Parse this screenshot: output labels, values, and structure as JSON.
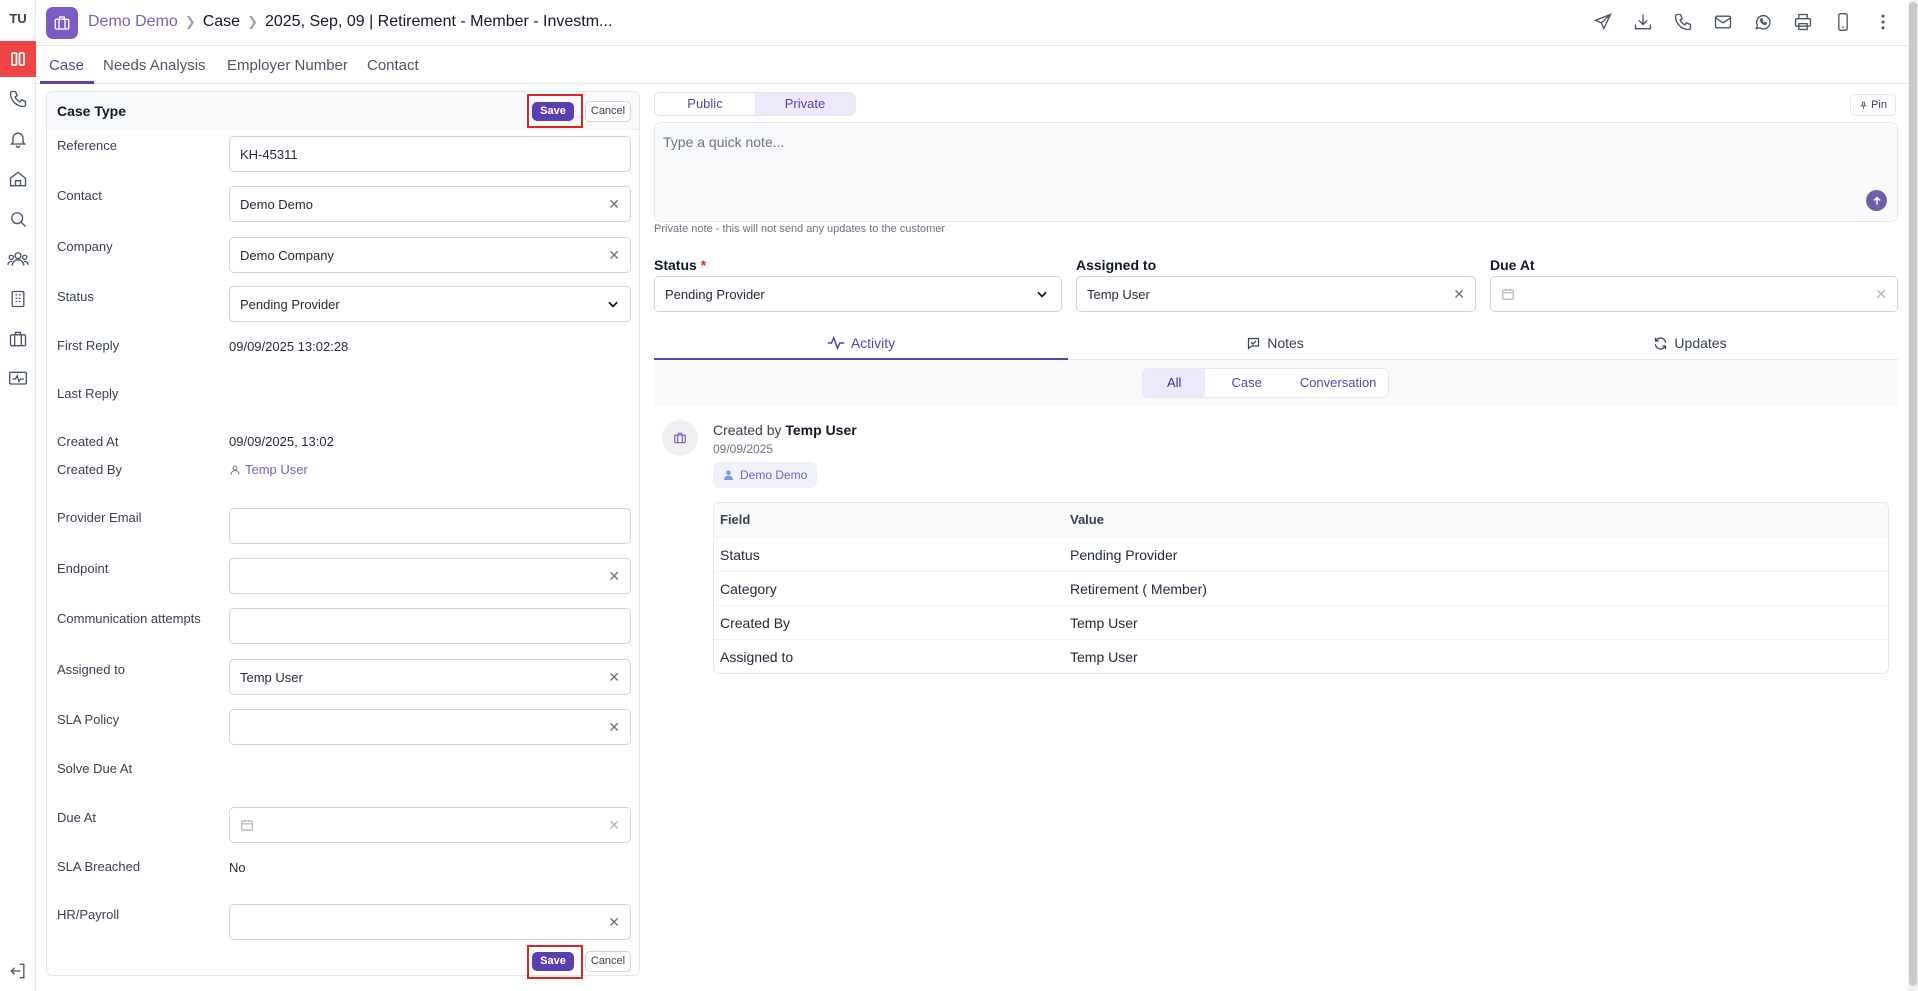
{
  "rail": {
    "avatar": "TU",
    "icons": [
      "panels-icon",
      "phone-icon",
      "bell-icon",
      "home-icon",
      "search-icon",
      "users-icon",
      "building-icon",
      "briefcase-icon",
      "monitor-pulse-icon",
      "logout-icon"
    ]
  },
  "header": {
    "crumb_contact": "Demo Demo",
    "crumb_case": "Case",
    "crumb_title": "2025, Sep, 09 | Retirement - Member - Investm...",
    "actions": [
      "send-icon",
      "download-icon",
      "phone-icon",
      "mail-icon",
      "whatsapp-icon",
      "printer-icon",
      "mobile-icon",
      "more-vertical-icon"
    ]
  },
  "tabs": {
    "case": "Case",
    "needs_analysis": "Needs Analysis",
    "employer_number": "Employer Number",
    "contact": "Contact"
  },
  "case_form": {
    "title": "Case Type",
    "save": "Save",
    "cancel": "Cancel",
    "fields": {
      "reference": {
        "label": "Reference",
        "value": "KH-45311"
      },
      "contact": {
        "label": "Contact",
        "value": "Demo Demo"
      },
      "company": {
        "label": "Company",
        "value": "Demo Company"
      },
      "status": {
        "label": "Status",
        "value": "Pending Provider"
      },
      "first_reply": {
        "label": "First Reply",
        "value": "09/09/2025 13:02:28"
      },
      "last_reply": {
        "label": "Last Reply",
        "value": ""
      },
      "created_at": {
        "label": "Created At",
        "value": "09/09/2025, 13:02"
      },
      "created_by": {
        "label": "Created By",
        "value": "Temp User"
      },
      "provider_email": {
        "label": "Provider Email",
        "value": ""
      },
      "endpoint": {
        "label": "Endpoint",
        "value": ""
      },
      "communication_attempts": {
        "label": "Communication attempts",
        "value": ""
      },
      "assigned_to": {
        "label": "Assigned to",
        "value": "Temp User"
      },
      "sla_policy": {
        "label": "SLA Policy",
        "value": ""
      },
      "solve_due_at": {
        "label": "Solve Due At",
        "value": ""
      },
      "due_at": {
        "label": "Due At",
        "value": ""
      },
      "sla_breached": {
        "label": "SLA Breached",
        "value": "No"
      },
      "hr_payroll": {
        "label": "HR/Payroll",
        "value": ""
      }
    }
  },
  "note": {
    "public": "Public",
    "private": "Private",
    "pin": "Pin",
    "placeholder": "Type a quick note...",
    "hint": "Private note - this will not send any updates to the customer"
  },
  "summary": {
    "status_label": "Status",
    "required_mark": "*",
    "status_value": "Pending Provider",
    "assigned_label": "Assigned to",
    "assigned_value": "Temp User",
    "due_label": "Due At",
    "due_value": ""
  },
  "activity_tabs": {
    "activity": "Activity",
    "notes": "Notes",
    "updates": "Updates"
  },
  "filters": {
    "all": "All",
    "case": "Case",
    "conversation": "Conversation"
  },
  "feed": {
    "created_by_prefix": "Created by",
    "created_by_user": "Temp User",
    "date": "09/09/2025",
    "chip": "Demo Demo",
    "table": {
      "headers": [
        "Field",
        "Value"
      ],
      "rows": [
        [
          "Status",
          "Pending Provider"
        ],
        [
          "Category",
          "Retirement ( Member)"
        ],
        [
          "Created By",
          "Temp User"
        ],
        [
          "Assigned to",
          "Temp User"
        ]
      ]
    }
  },
  "colors": {
    "accent": "#5b3fb0",
    "brand": "#7c5cc4",
    "highlight_box": "#dc2626",
    "rail_active": "#ef4444"
  }
}
